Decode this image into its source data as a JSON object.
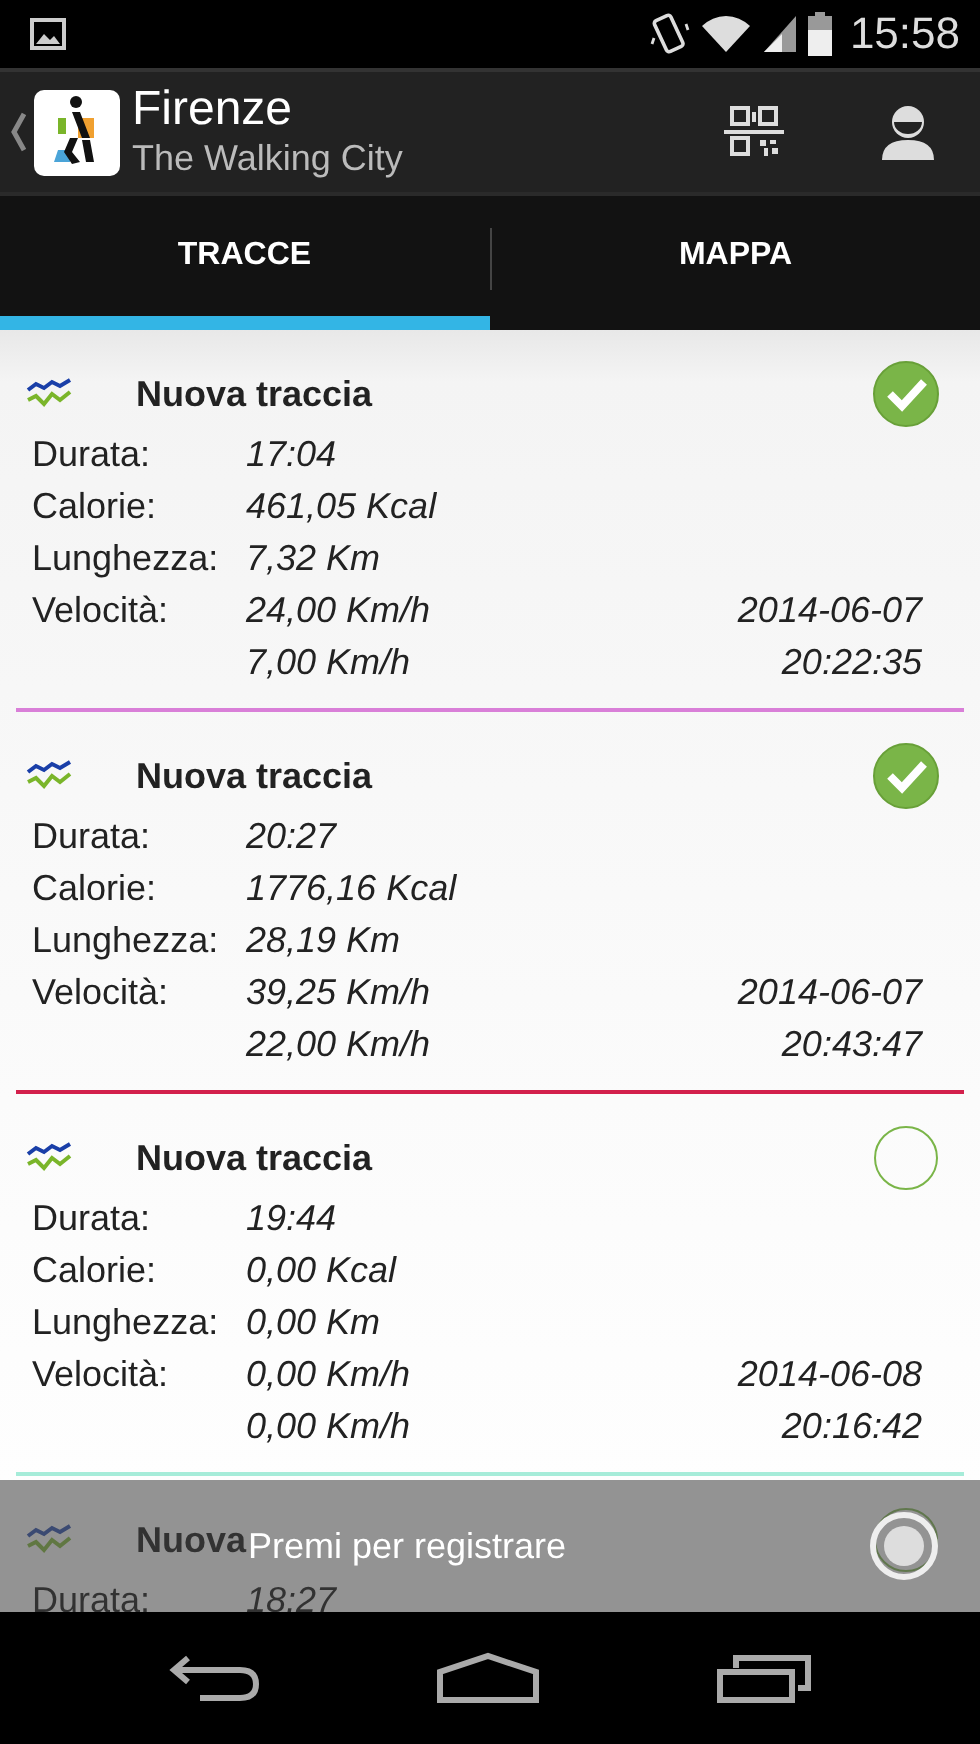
{
  "status_bar": {
    "time": "15:58"
  },
  "app_bar": {
    "title": "Firenze",
    "subtitle": "The Walking City"
  },
  "tabs": [
    {
      "label": "TRACCE",
      "selected": true
    },
    {
      "label": "MAPPA",
      "selected": false
    }
  ],
  "tracks": [
    {
      "title": "Nuova traccia",
      "checked": true,
      "color": "#d97fd8",
      "rows": [
        {
          "label": "Durata:",
          "value": "17:04"
        },
        {
          "label": "Calorie:",
          "value": "461,05 Kcal"
        },
        {
          "label": "Lunghezza:",
          "value": "7,32 Km"
        },
        {
          "label": "Velocità:",
          "value": "24,00 Km/h",
          "side": "2014-06-07"
        },
        {
          "value": "7,00 Km/h",
          "side": "20:22:35"
        }
      ]
    },
    {
      "title": "Nuova traccia",
      "checked": true,
      "color": "#d3204c",
      "rows": [
        {
          "label": "Durata:",
          "value": "20:27"
        },
        {
          "label": "Calorie:",
          "value": "1776,16 Kcal"
        },
        {
          "label": "Lunghezza:",
          "value": "28,19 Km"
        },
        {
          "label": "Velocità:",
          "value": "39,25 Km/h",
          "side": "2014-06-07"
        },
        {
          "value": "22,00 Km/h",
          "side": "20:43:47"
        }
      ]
    },
    {
      "title": "Nuova traccia",
      "checked": false,
      "color": "#a6ecd9",
      "rows": [
        {
          "label": "Durata:",
          "value": "19:44"
        },
        {
          "label": "Calorie:",
          "value": "0,00 Kcal"
        },
        {
          "label": "Lunghezza:",
          "value": "0,00 Km"
        },
        {
          "label": "Velocità:",
          "value": "0,00 Km/h",
          "side": "2014-06-08"
        },
        {
          "value": "0,00 Km/h",
          "side": "20:16:42"
        }
      ]
    },
    {
      "title": "Nuova",
      "checked": false,
      "rows": [
        {
          "label": "Durata:",
          "value": "18:27"
        }
      ]
    }
  ],
  "record_bar": {
    "label": "Premi per registrare"
  }
}
